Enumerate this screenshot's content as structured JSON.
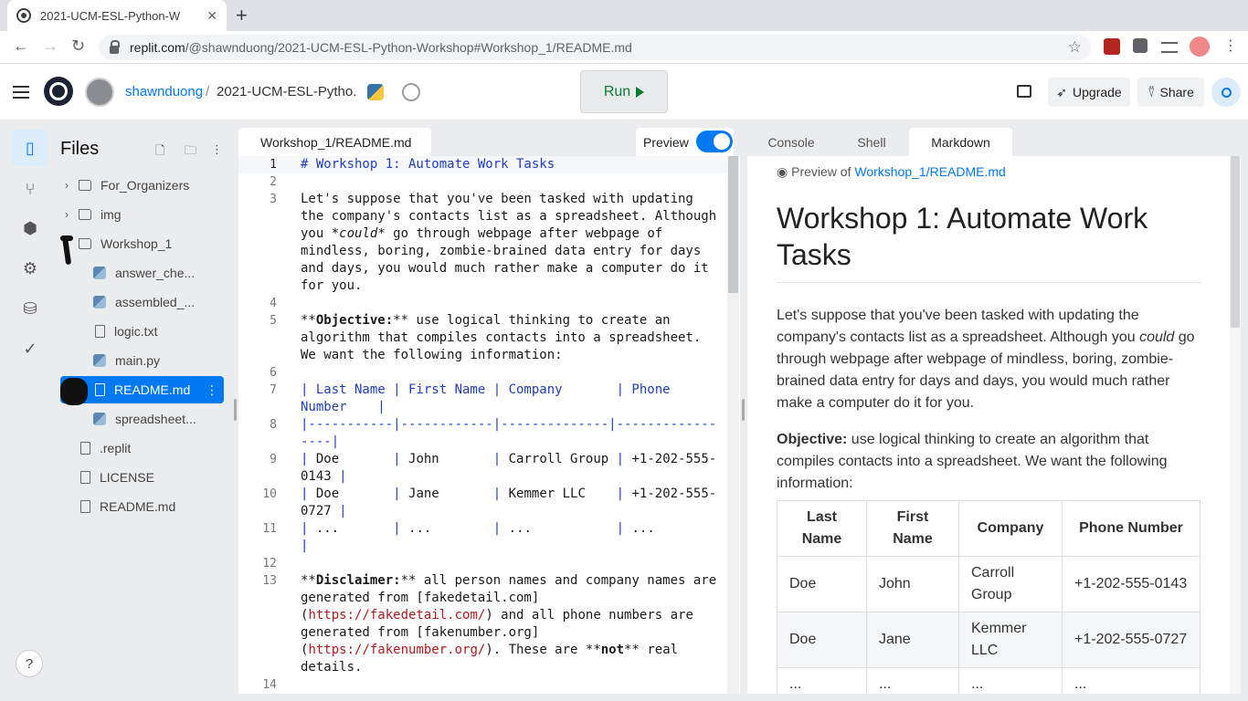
{
  "browser": {
    "tab_title": "2021-UCM-ESL-Python-W",
    "tab_close": "✕",
    "new_tab": "+",
    "url_host": "replit.com",
    "url_path": "/@shawnduong/2021-UCM-ESL-Python-Workshop#Workshop_1/README.md",
    "back": "←",
    "forward": "→",
    "reload": "↻",
    "bookmark": "☆"
  },
  "header": {
    "user": "shawnduong",
    "separator": "/",
    "project": "2021-UCM-ESL-Pytho...",
    "run_label": "Run",
    "upgrade_label": "Upgrade",
    "share_label": "Share"
  },
  "files": {
    "title": "Files",
    "items": [
      {
        "label": "For_Organizers",
        "type": "folder",
        "chevron": "›"
      },
      {
        "label": "img",
        "type": "folder",
        "chevron": "›"
      },
      {
        "label": "Workshop_1",
        "type": "folder",
        "chevron": "⌄"
      },
      {
        "label": "answer_che...",
        "type": "python"
      },
      {
        "label": "assembled_...",
        "type": "python"
      },
      {
        "label": "logic.txt",
        "type": "file"
      },
      {
        "label": "main.py",
        "type": "python"
      },
      {
        "label": "README.md",
        "type": "file",
        "selected": true,
        "menu": "⋮"
      },
      {
        "label": "spreadsheet...",
        "type": "python"
      },
      {
        "label": ".replit",
        "type": "file"
      },
      {
        "label": "LICENSE",
        "type": "file"
      },
      {
        "label": "README.md",
        "type": "file"
      }
    ]
  },
  "editor": {
    "tab": "Workshop_1/README.md",
    "preview_label": "Preview",
    "line_numbers": [
      "1",
      "2",
      "3",
      "4",
      "5",
      "6",
      "7",
      "8",
      "9",
      "10",
      "11",
      "12",
      "13",
      "14"
    ]
  },
  "right_panel": {
    "tabs": [
      "Console",
      "Shell",
      "Markdown"
    ],
    "active_tab": "Markdown",
    "preview_of": "Preview of",
    "preview_link": "Workshop_1/README.md",
    "h1": "Workshop 1: Automate Work Tasks",
    "p1_a": "Let's suppose that you've been tasked with updating the company's contacts list as a spreadsheet. Although you ",
    "p1_em": "could",
    "p1_b": " go through webpage after webpage of mindless, boring, zombie-brained data entry for days and days, you would much rather make a computer do it for you.",
    "p2_strong": "Objective:",
    "p2_rest": " use logical thinking to create an algorithm that compiles contacts into a spreadsheet. We want the following information:",
    "table": {
      "headers": [
        "Last Name",
        "First Name",
        "Company",
        "Phone Number"
      ],
      "rows": [
        [
          "Doe",
          "John",
          "Carroll Group",
          "+1-202-555-0143"
        ],
        [
          "Doe",
          "Jane",
          "Kemmer LLC",
          "+1-202-555-0727"
        ],
        [
          "...",
          "...",
          "...",
          "..."
        ]
      ]
    }
  },
  "help_label": "?"
}
